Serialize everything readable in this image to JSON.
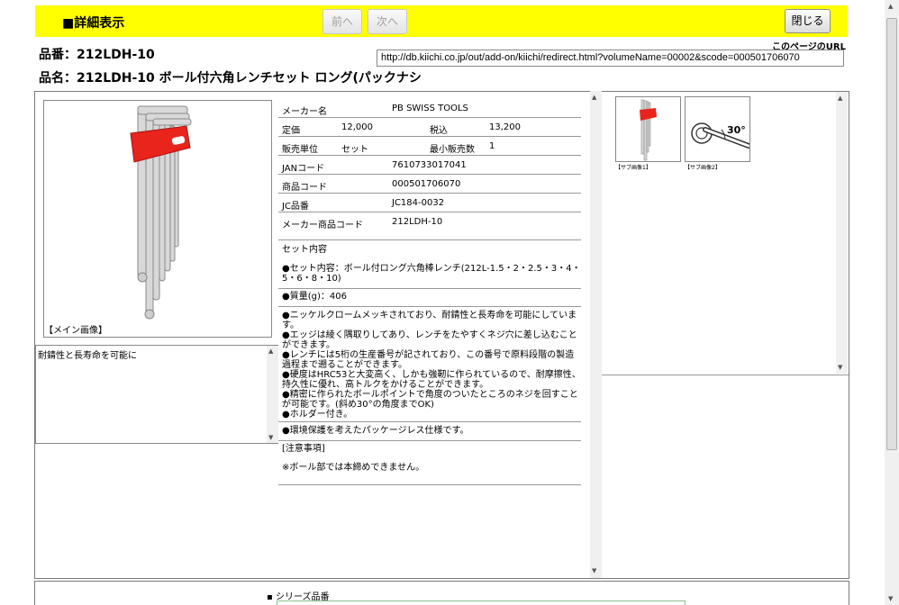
{
  "header": {
    "title": "■詳細表示",
    "prev_label": "前へ",
    "next_label": "次へ",
    "close_label": "閉じる"
  },
  "product": {
    "code_label": "品番：",
    "code": "212LDH-10",
    "name_label": "品名：",
    "name": "212LDH-10 ボール付六角レンチセット ロング(パックナシ"
  },
  "url": {
    "label": "このページのURL",
    "value": "http://db.kiichi.co.jp/out/add-on/kiichi/redirect.html?volumeName=00002&scode=000501706070"
  },
  "main_image": {
    "caption": "【メイン画像】"
  },
  "note_box": {
    "text": "耐錆性と長寿命を可能に"
  },
  "spec": {
    "maker_label": "メーカー名",
    "maker": "PB SWISS TOOLS",
    "price_label": "定価",
    "price": "12,000",
    "tax_label": "税込",
    "tax_price": "13,200",
    "unit_label": "販売単位",
    "unit": "セット",
    "min_label": "最小販売数",
    "min": "1",
    "jan_label": "JANコード",
    "jan": "7610733017041",
    "item_code_label": "商品コード",
    "item_code": "000501706070",
    "jc_label": "JC品番",
    "jc": "JC184-0032",
    "maker_code_label": "メーカー商品コード",
    "maker_code": "212LDH-10"
  },
  "contents": {
    "title": "セット内容",
    "set": "●セット内容：ボール付ロング六角棒レンチ(212L-1.5・2・2.5・3・4・5・6・8・10)",
    "weight": "●質量(g)：406",
    "features": [
      "●ニッケルクロームメッキされており、耐錆性と長寿命を可能にしています。",
      "●エッジは綾く隅取りしてあり、レンチをたやすくネジ穴に差し込むことができます。",
      "●レンチには5桁の生産番号が記されており、この番号で原料段階の製造過程まで遡ることができます。",
      "●硬度はHRC53と大変高く、しかも強靭に作られているので、耐摩擦性、持久性に優れ、高トルクをかけることができます。",
      "●精密に作られたボールポイントで角度のついたところのネジを回すことが可能です。(斜め30°の角度までOK)",
      "●ホルダー付き。"
    ],
    "eco": "●環境保護を考えたパッケージレス仕様です。",
    "caution_title": "[注意事項]",
    "caution": "※ボール部では本締めできません。"
  },
  "sub_images": [
    {
      "caption": "【サブ画像1】"
    },
    {
      "caption": "【サブ画像2】"
    }
  ],
  "angle_text": "30°",
  "series": {
    "title": "シリーズ品番"
  }
}
